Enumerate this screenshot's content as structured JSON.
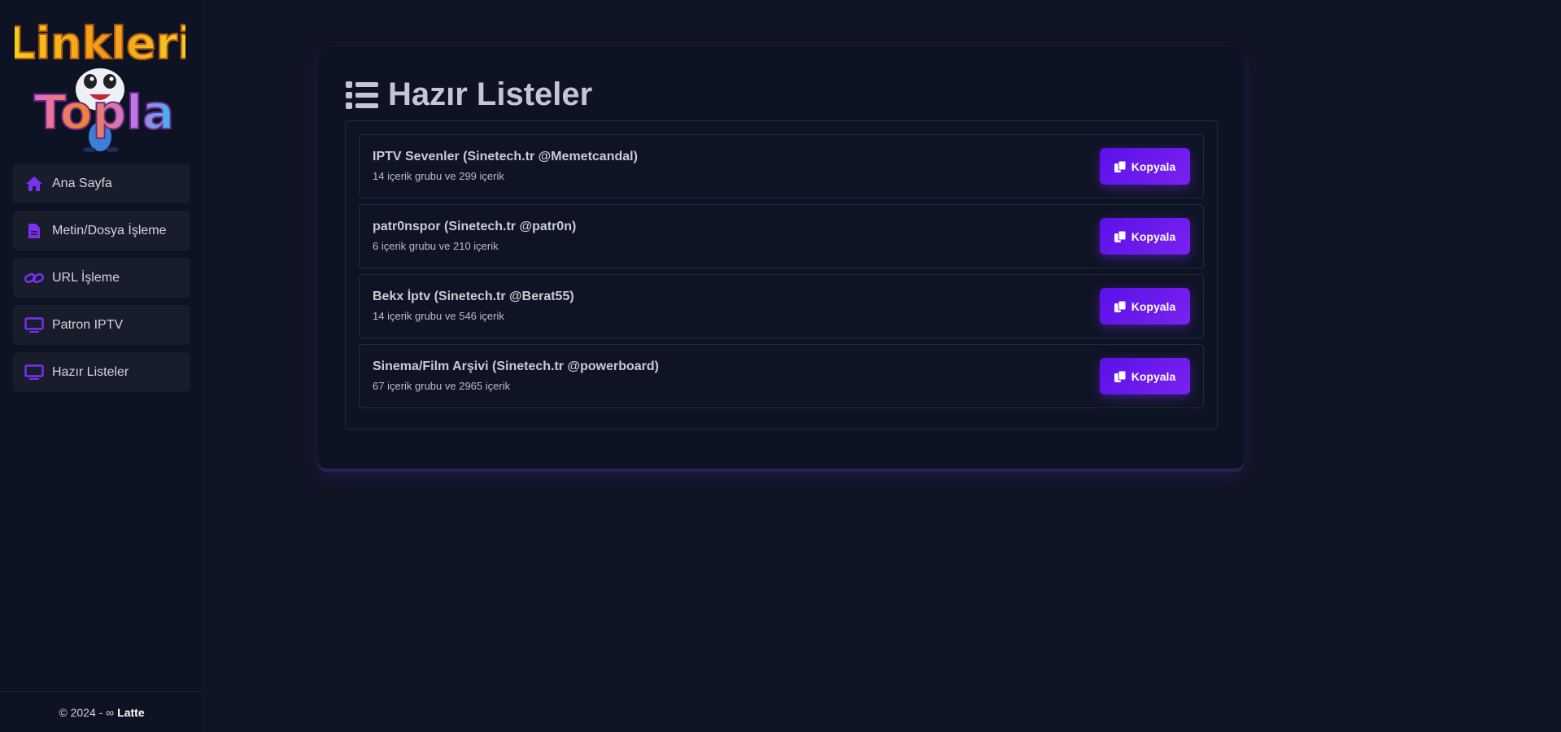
{
  "brand": {
    "logo_line1": "Linkleri",
    "logo_line2": "Topla"
  },
  "sidebar": {
    "items": [
      {
        "label": "Ana Sayfa",
        "icon": "home-icon"
      },
      {
        "label": "Metin/Dosya İşleme",
        "icon": "file-icon"
      },
      {
        "label": "URL İşleme",
        "icon": "link-icon"
      },
      {
        "label": "Patron IPTV",
        "icon": "monitor-icon"
      },
      {
        "label": "Hazır Listeler",
        "icon": "monitor-icon"
      }
    ],
    "footer_text": "© 2024 - ∞",
    "footer_author": "Latte"
  },
  "main": {
    "title": "Hazır Listeler",
    "title_icon": "list-icon",
    "lists": [
      {
        "name": "IPTV Sevenler (Sinetech.tr @Memetcandal)",
        "meta": "14 içerik grubu ve 299 içerik",
        "button": "Kopyala"
      },
      {
        "name": "patr0nspor (Sinetech.tr @patr0n)",
        "meta": "6 içerik grubu ve 210 içerik",
        "button": "Kopyala"
      },
      {
        "name": "Bekx İptv (Sinetech.tr @Berat55)",
        "meta": "14 içerik grubu ve 546 içerik",
        "button": "Kopyala"
      },
      {
        "name": "Sinema/Film Arşivi (Sinetech.tr @powerboard)",
        "meta": "67 içerik grubu ve 2965 içerik",
        "button": "Kopyala"
      }
    ]
  },
  "colors": {
    "background": "#0f1424",
    "accent": "#6a1bed",
    "icon_accent": "#7b2ff0"
  }
}
